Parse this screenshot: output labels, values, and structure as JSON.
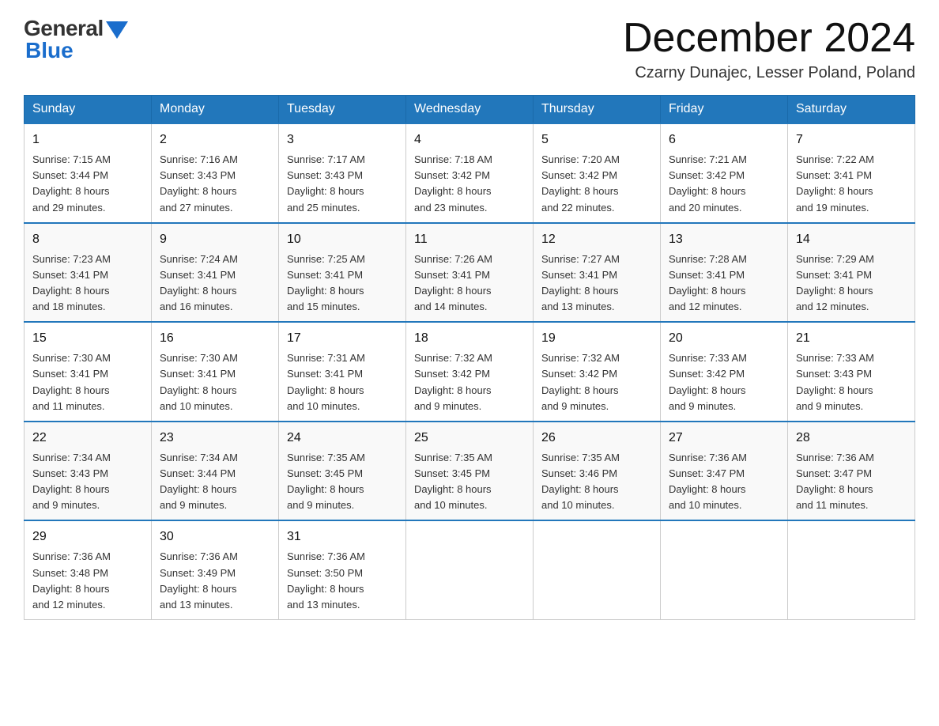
{
  "logo": {
    "general": "General",
    "blue": "Blue"
  },
  "title": "December 2024",
  "location": "Czarny Dunajec, Lesser Poland, Poland",
  "headers": [
    "Sunday",
    "Monday",
    "Tuesday",
    "Wednesday",
    "Thursday",
    "Friday",
    "Saturday"
  ],
  "weeks": [
    [
      {
        "day": "1",
        "sunrise": "7:15 AM",
        "sunset": "3:44 PM",
        "daylight": "8 hours and 29 minutes."
      },
      {
        "day": "2",
        "sunrise": "7:16 AM",
        "sunset": "3:43 PM",
        "daylight": "8 hours and 27 minutes."
      },
      {
        "day": "3",
        "sunrise": "7:17 AM",
        "sunset": "3:43 PM",
        "daylight": "8 hours and 25 minutes."
      },
      {
        "day": "4",
        "sunrise": "7:18 AM",
        "sunset": "3:42 PM",
        "daylight": "8 hours and 23 minutes."
      },
      {
        "day": "5",
        "sunrise": "7:20 AM",
        "sunset": "3:42 PM",
        "daylight": "8 hours and 22 minutes."
      },
      {
        "day": "6",
        "sunrise": "7:21 AM",
        "sunset": "3:42 PM",
        "daylight": "8 hours and 20 minutes."
      },
      {
        "day": "7",
        "sunrise": "7:22 AM",
        "sunset": "3:41 PM",
        "daylight": "8 hours and 19 minutes."
      }
    ],
    [
      {
        "day": "8",
        "sunrise": "7:23 AM",
        "sunset": "3:41 PM",
        "daylight": "8 hours and 18 minutes."
      },
      {
        "day": "9",
        "sunrise": "7:24 AM",
        "sunset": "3:41 PM",
        "daylight": "8 hours and 16 minutes."
      },
      {
        "day": "10",
        "sunrise": "7:25 AM",
        "sunset": "3:41 PM",
        "daylight": "8 hours and 15 minutes."
      },
      {
        "day": "11",
        "sunrise": "7:26 AM",
        "sunset": "3:41 PM",
        "daylight": "8 hours and 14 minutes."
      },
      {
        "day": "12",
        "sunrise": "7:27 AM",
        "sunset": "3:41 PM",
        "daylight": "8 hours and 13 minutes."
      },
      {
        "day": "13",
        "sunrise": "7:28 AM",
        "sunset": "3:41 PM",
        "daylight": "8 hours and 12 minutes."
      },
      {
        "day": "14",
        "sunrise": "7:29 AM",
        "sunset": "3:41 PM",
        "daylight": "8 hours and 12 minutes."
      }
    ],
    [
      {
        "day": "15",
        "sunrise": "7:30 AM",
        "sunset": "3:41 PM",
        "daylight": "8 hours and 11 minutes."
      },
      {
        "day": "16",
        "sunrise": "7:30 AM",
        "sunset": "3:41 PM",
        "daylight": "8 hours and 10 minutes."
      },
      {
        "day": "17",
        "sunrise": "7:31 AM",
        "sunset": "3:41 PM",
        "daylight": "8 hours and 10 minutes."
      },
      {
        "day": "18",
        "sunrise": "7:32 AM",
        "sunset": "3:42 PM",
        "daylight": "8 hours and 9 minutes."
      },
      {
        "day": "19",
        "sunrise": "7:32 AM",
        "sunset": "3:42 PM",
        "daylight": "8 hours and 9 minutes."
      },
      {
        "day": "20",
        "sunrise": "7:33 AM",
        "sunset": "3:42 PM",
        "daylight": "8 hours and 9 minutes."
      },
      {
        "day": "21",
        "sunrise": "7:33 AM",
        "sunset": "3:43 PM",
        "daylight": "8 hours and 9 minutes."
      }
    ],
    [
      {
        "day": "22",
        "sunrise": "7:34 AM",
        "sunset": "3:43 PM",
        "daylight": "8 hours and 9 minutes."
      },
      {
        "day": "23",
        "sunrise": "7:34 AM",
        "sunset": "3:44 PM",
        "daylight": "8 hours and 9 minutes."
      },
      {
        "day": "24",
        "sunrise": "7:35 AM",
        "sunset": "3:45 PM",
        "daylight": "8 hours and 9 minutes."
      },
      {
        "day": "25",
        "sunrise": "7:35 AM",
        "sunset": "3:45 PM",
        "daylight": "8 hours and 10 minutes."
      },
      {
        "day": "26",
        "sunrise": "7:35 AM",
        "sunset": "3:46 PM",
        "daylight": "8 hours and 10 minutes."
      },
      {
        "day": "27",
        "sunrise": "7:36 AM",
        "sunset": "3:47 PM",
        "daylight": "8 hours and 10 minutes."
      },
      {
        "day": "28",
        "sunrise": "7:36 AM",
        "sunset": "3:47 PM",
        "daylight": "8 hours and 11 minutes."
      }
    ],
    [
      {
        "day": "29",
        "sunrise": "7:36 AM",
        "sunset": "3:48 PM",
        "daylight": "8 hours and 12 minutes."
      },
      {
        "day": "30",
        "sunrise": "7:36 AM",
        "sunset": "3:49 PM",
        "daylight": "8 hours and 13 minutes."
      },
      {
        "day": "31",
        "sunrise": "7:36 AM",
        "sunset": "3:50 PM",
        "daylight": "8 hours and 13 minutes."
      },
      null,
      null,
      null,
      null
    ]
  ],
  "labels": {
    "sunrise": "Sunrise:",
    "sunset": "Sunset:",
    "daylight": "Daylight:"
  }
}
